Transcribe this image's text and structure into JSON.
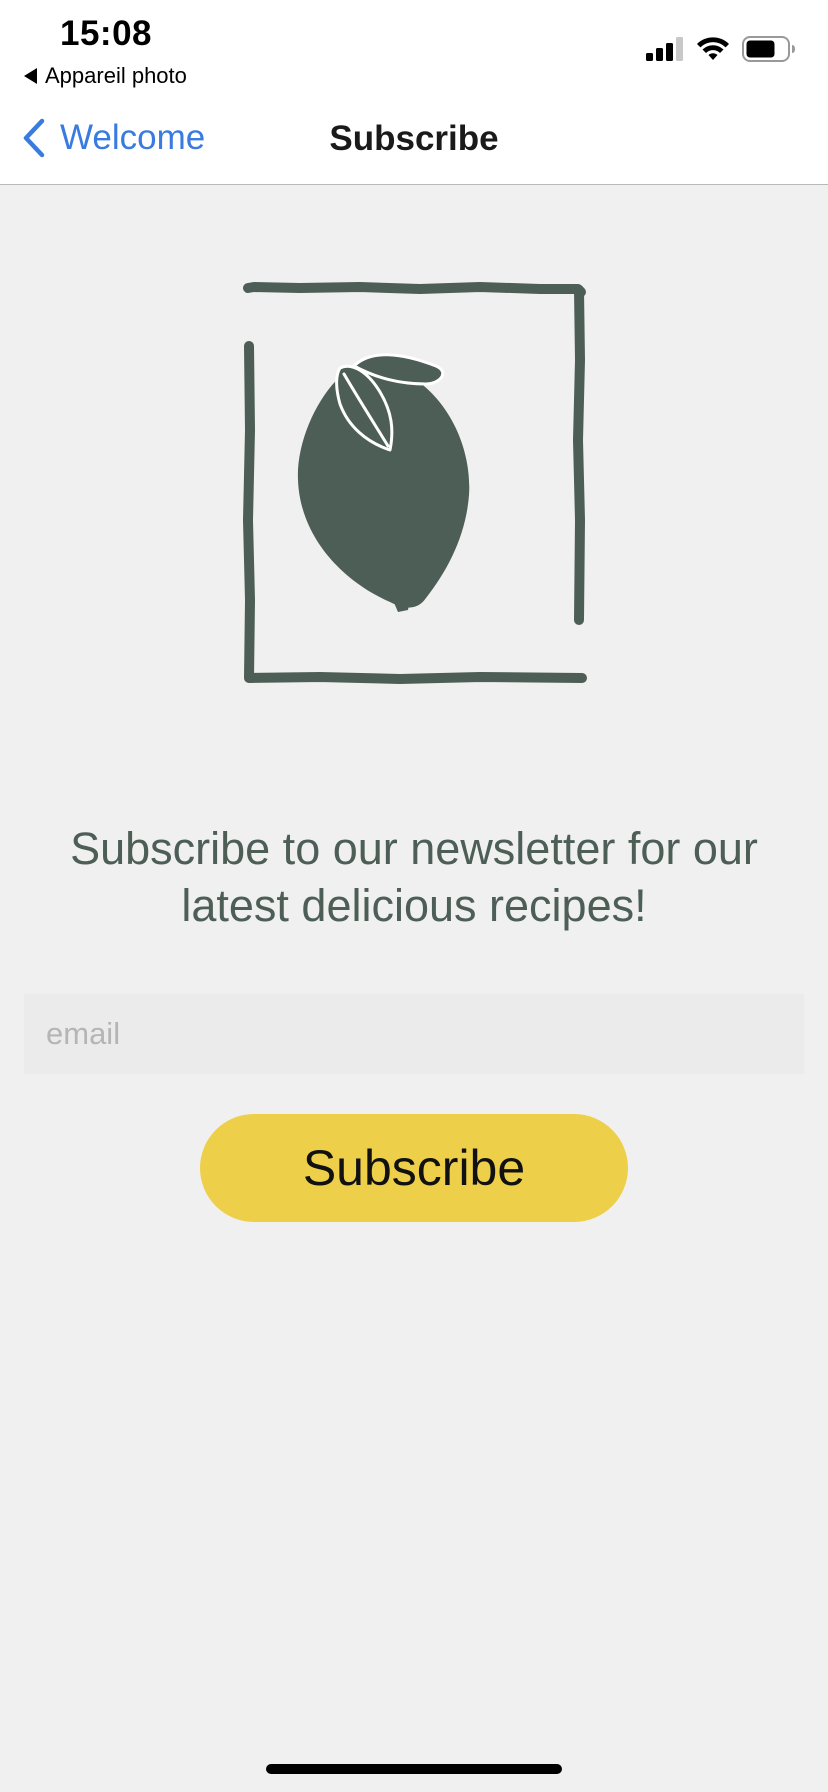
{
  "status_bar": {
    "time": "15:08",
    "back_app_label": "Appareil photo"
  },
  "nav": {
    "back_label": "Welcome",
    "title": "Subscribe"
  },
  "main": {
    "headline": "Subscribe to our newsletter for our latest delicious recipes!",
    "email_placeholder": "email",
    "email_value": "",
    "subscribe_label": "Subscribe"
  },
  "colors": {
    "accent_blue": "#3a7be0",
    "logo_green": "#4d5e57",
    "button_yellow": "#eecf4a",
    "background": "#f0f0f0"
  },
  "icons": [
    "signal-icon",
    "wifi-icon",
    "battery-icon",
    "chevron-left-icon",
    "lemon-logo-icon"
  ]
}
